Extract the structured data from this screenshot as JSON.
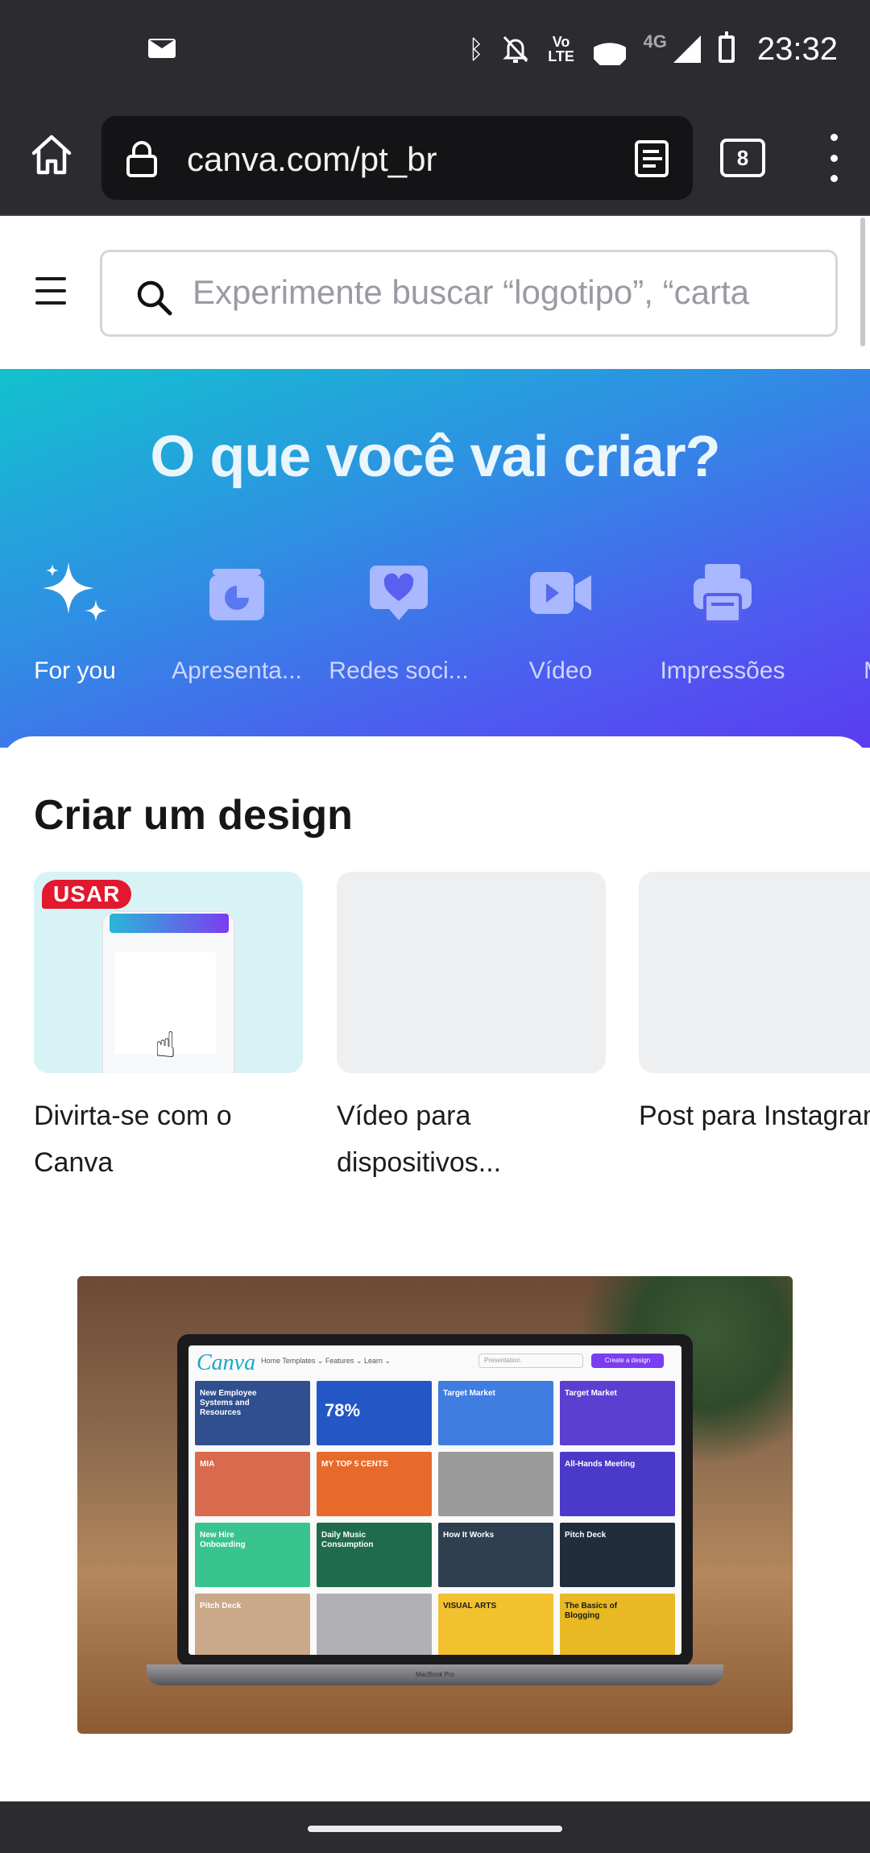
{
  "status_bar": {
    "time": "23:32",
    "network": "4G",
    "volte": "Vo LTE",
    "icons": [
      "mail-icon",
      "bluetooth-icon",
      "bell-off-icon",
      "volte-icon",
      "wifi-icon",
      "signal-icon",
      "battery-icon"
    ]
  },
  "browser": {
    "url": "canva.com/pt_br",
    "tab_count": "8"
  },
  "header": {
    "search_placeholder": "Experimente buscar “logotipo”, “carta"
  },
  "hero": {
    "title": "O que você vai criar?",
    "categories": [
      {
        "label": "For you",
        "icon": "sparkle-icon",
        "active": true
      },
      {
        "label": "Apresenta...",
        "icon": "presentation-icon",
        "active": false
      },
      {
        "label": "Redes soci...",
        "icon": "heart-chat-icon",
        "active": false
      },
      {
        "label": "Vídeo",
        "icon": "video-camera-icon",
        "active": false
      },
      {
        "label": "Impressões",
        "icon": "printer-icon",
        "active": false
      },
      {
        "label": "Mar",
        "icon": "megaphone-icon",
        "active": false
      }
    ]
  },
  "create_section": {
    "title": "Criar um design",
    "cards": [
      {
        "caption": "Divirta-se com o Canva",
        "badge": "USAR"
      },
      {
        "caption": "Vídeo para dispositivos..."
      },
      {
        "caption": "Post para Instagram"
      }
    ]
  },
  "promo": {
    "logo": "Canva",
    "nav": "Home   Templates ⌄   Features ⌄   Learn ⌄",
    "search_placeholder": "Presentation",
    "create_button": "Create a design",
    "tiles": [
      {
        "text": "New Employee Systems and Resources",
        "color": "#2f4f8f"
      },
      {
        "text": "78%",
        "color": "#2457c5"
      },
      {
        "text": "Target Market",
        "color": "#3f7de0"
      },
      {
        "text": "Target Market",
        "color": "#5a3fd0"
      },
      {
        "text": "MIA",
        "color": "#d96a4d"
      },
      {
        "text": "MY TOP 5 CENTS",
        "color": "#e86a2a"
      },
      {
        "text": "",
        "color": "#9a9a9a"
      },
      {
        "text": "All-Hands Meeting",
        "color": "#4b39c9"
      },
      {
        "text": "New Hire Onboarding",
        "color": "#39c48f"
      },
      {
        "text": "Daily Music Consumption",
        "color": "#1f6b4e"
      },
      {
        "text": "How It Works",
        "color": "#2e3f4f"
      },
      {
        "text": "Pitch Deck",
        "color": "#1f2d3d"
      },
      {
        "text": "Pitch Deck",
        "color": "#c9a98a"
      },
      {
        "text": "",
        "color": "#b0b0b5"
      },
      {
        "text": "VISUAL ARTS",
        "color": "#f2c12e"
      },
      {
        "text": "The Basics of Blogging",
        "color": "#e8b923"
      }
    ],
    "device_label": "MacBook Pro"
  }
}
